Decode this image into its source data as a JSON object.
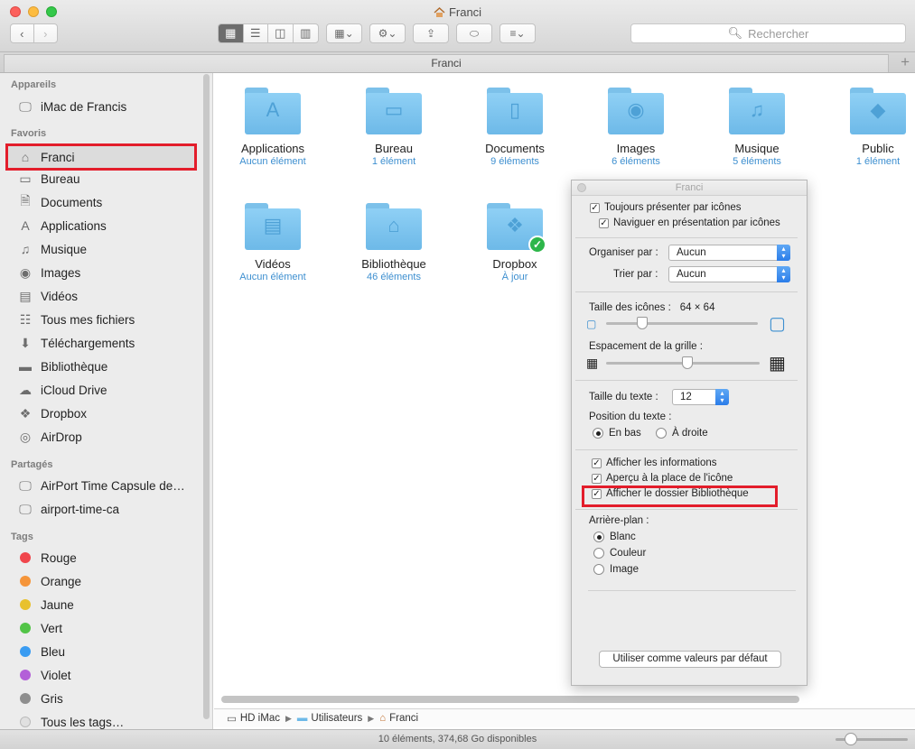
{
  "window": {
    "title": "Franci"
  },
  "toolbar": {
    "search_placeholder": "Rechercher"
  },
  "tab": {
    "label": "Franci"
  },
  "sidebar": {
    "sections": [
      {
        "heading": "Appareils",
        "items": [
          {
            "label": "iMac de Francis",
            "icon": "imac-icon"
          }
        ]
      },
      {
        "heading": "Favoris",
        "items": [
          {
            "label": "Franci",
            "icon": "home-icon",
            "selected": true
          },
          {
            "label": "Bureau",
            "icon": "desktop-icon"
          },
          {
            "label": "Documents",
            "icon": "document-icon"
          },
          {
            "label": "Applications",
            "icon": "applications-icon"
          },
          {
            "label": "Musique",
            "icon": "music-icon"
          },
          {
            "label": "Images",
            "icon": "camera-icon"
          },
          {
            "label": "Vidéos",
            "icon": "film-icon"
          },
          {
            "label": "Tous mes fichiers",
            "icon": "all-files-icon"
          },
          {
            "label": "Téléchargements",
            "icon": "download-icon"
          },
          {
            "label": "Bibliothèque",
            "icon": "folder-icon"
          },
          {
            "label": "iCloud Drive",
            "icon": "cloud-icon"
          },
          {
            "label": "Dropbox",
            "icon": "dropbox-icon"
          },
          {
            "label": "AirDrop",
            "icon": "airdrop-icon"
          }
        ]
      },
      {
        "heading": "Partagés",
        "items": [
          {
            "label": "AirPort Time Capsule de…",
            "icon": "display-icon"
          },
          {
            "label": "airport-time-ca",
            "icon": "display-icon"
          }
        ]
      },
      {
        "heading": "Tags",
        "items": [
          {
            "label": "Rouge",
            "color": "#f0464c"
          },
          {
            "label": "Orange",
            "color": "#f5953a"
          },
          {
            "label": "Jaune",
            "color": "#e8c12e"
          },
          {
            "label": "Vert",
            "color": "#52c447"
          },
          {
            "label": "Bleu",
            "color": "#3a9cf2"
          },
          {
            "label": "Violet",
            "color": "#b360d8"
          },
          {
            "label": "Gris",
            "color": "#8e8e8e"
          },
          {
            "label": "Tous les tags…",
            "color": "#e0e0e0"
          }
        ]
      }
    ]
  },
  "files": [
    {
      "name": "Applications",
      "count": "Aucun élément",
      "icon": "applications-icon"
    },
    {
      "name": "Bureau",
      "count": "1 élément",
      "icon": "desktop-icon"
    },
    {
      "name": "Documents",
      "count": "9 éléments",
      "icon": "document-icon"
    },
    {
      "name": "Images",
      "count": "6 éléments",
      "icon": "camera-icon"
    },
    {
      "name": "Musique",
      "count": "5 éléments",
      "icon": "music-icon"
    },
    {
      "name": "Public",
      "count": "1 élément",
      "icon": "public-icon"
    },
    {
      "name": "Vidéos",
      "count": "Aucun élément",
      "icon": "film-icon"
    },
    {
      "name": "Bibliothèque",
      "count": "46 éléments",
      "icon": "library-icon"
    },
    {
      "name": "Dropbox",
      "count": "À jour",
      "icon": "dropbox-icon",
      "synced": true
    }
  ],
  "pathbar": [
    {
      "label": "HD iMac",
      "icon": "disk-icon"
    },
    {
      "label": "Utilisateurs",
      "icon": "folder-icon"
    },
    {
      "label": "Franci",
      "icon": "home-icon"
    }
  ],
  "status": {
    "text": "10 éléments, 374,68 Go disponibles"
  },
  "panel": {
    "title": "Franci",
    "always_icons": "Toujours présenter par icônes",
    "browse_icons": "Naviguer en présentation par icônes",
    "arrange_label": "Organiser par :",
    "arrange_value": "Aucun",
    "sort_label": "Trier par :",
    "sort_value": "Aucun",
    "icon_size_label": "Taille des icônes :",
    "icon_size_value": "64 × 64",
    "icon_size_fraction": 0.24,
    "grid_label": "Espacement de la grille :",
    "grid_fraction": 0.53,
    "text_size_label": "Taille du texte :",
    "text_size_value": "12",
    "text_pos_label": "Position du texte :",
    "text_pos_bottom": "En bas",
    "text_pos_right": "À droite",
    "show_info": "Afficher les informations",
    "preview_icon": "Aperçu à la place de l'icône",
    "show_library": "Afficher le dossier Bibliothèque",
    "background_label": "Arrière-plan :",
    "bg_white": "Blanc",
    "bg_color": "Couleur",
    "bg_image": "Image",
    "default_button": "Utiliser comme valeurs par défaut"
  }
}
